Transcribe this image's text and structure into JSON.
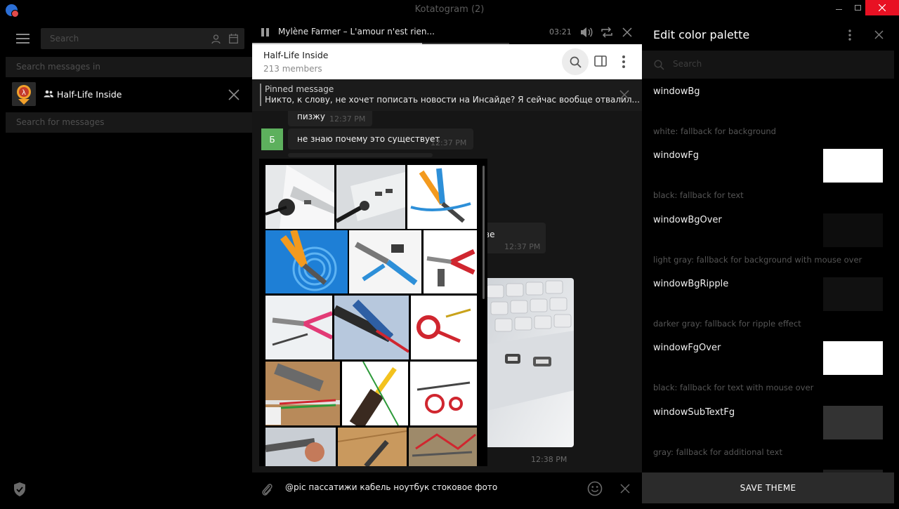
{
  "window": {
    "title": "Kotatogram (2)"
  },
  "sidebar": {
    "search_placeholder": "Search",
    "search_in_label": "Search messages in",
    "chat_name": "Half-Life Inside",
    "search_messages_placeholder": "Search for messages"
  },
  "player": {
    "track": "Mylène Farmer – L'amour n'est rien...",
    "time": "03:21",
    "progress_fraction": 0.66
  },
  "chat": {
    "name": "Half-Life Inside",
    "members": "213 members",
    "pinned_title": "Pinned message",
    "pinned_text": "Никто, к слову, не хочет пописать новости на Инсайде?  Я сейчас вообще отвалил...",
    "messages": [
      {
        "text": "пизжу",
        "time": "12:37 PM"
      },
      {
        "avatar": "Б",
        "text": "не знаю почему это существует",
        "time": "12:37 PM"
      },
      {
        "text": "ве",
        "time": "12:37 PM"
      },
      {
        "time": "12:38 PM"
      }
    ]
  },
  "compose": {
    "text": "@pic пассатижи кабель ноутбук стоковое фото"
  },
  "panel": {
    "title": "Edit color palette",
    "search_placeholder": "Search",
    "items": [
      {
        "name": "windowBg",
        "desc": "white: fallback for background",
        "color": "#000000"
      },
      {
        "name": "windowFg",
        "desc": "black: fallback for text",
        "color": "#ffffff"
      },
      {
        "name": "windowBgOver",
        "desc": "light gray: fallback for background with mouse over",
        "color": "#0d0d0d"
      },
      {
        "name": "windowBgRipple",
        "desc": "darker gray: fallback for ripple effect",
        "color": "#111111"
      },
      {
        "name": "windowFgOver",
        "desc": "black: fallback for text with mouse over",
        "color": "#ffffff"
      },
      {
        "name": "windowSubTextFg",
        "desc": "gray: fallback for additional text",
        "color": "#333333"
      },
      {
        "name": "",
        "desc": "",
        "color": "#1f1f1f"
      }
    ],
    "save_label": "SAVE THEME"
  }
}
